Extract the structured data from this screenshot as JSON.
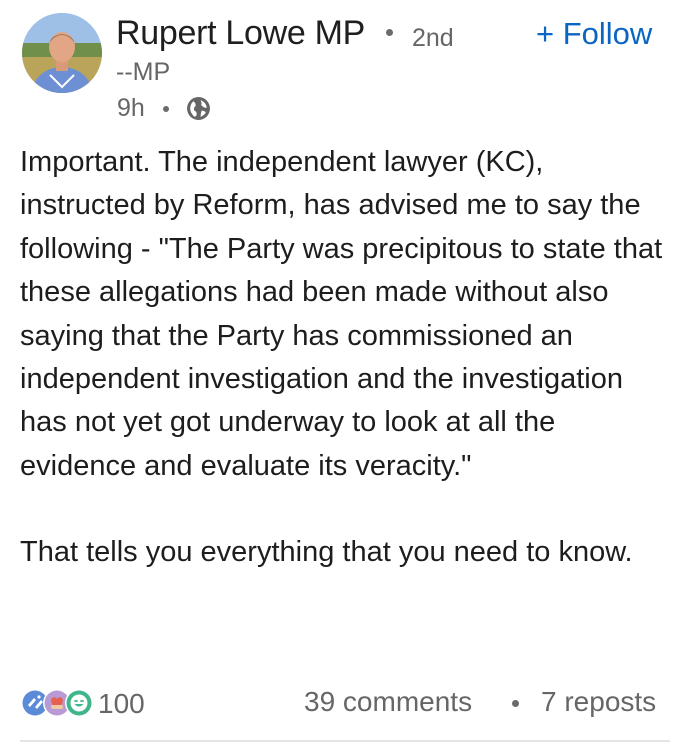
{
  "post": {
    "author": {
      "name": "Rupert Lowe MP",
      "degree": "2nd",
      "headline": "--MP",
      "avatar_icon": "profile-photo"
    },
    "follow_label": "+ Follow",
    "timestamp": "9h",
    "visibility_icon": "globe-icon",
    "body": {
      "paragraph1": "Important. The independent lawyer (KC), instructed by Reform, has advised me to say the following - \"The Party was precipitous to state that these allegations had been made without also saying that the Party has commissioned an independent investigation and the investigation has not yet got underway to look at all the evidence and evaluate its veracity.\"",
      "paragraph2": "That tells you everything that you need to know."
    },
    "social": {
      "reaction_icons": [
        "celebrate-icon",
        "support-icon",
        "funny-icon"
      ],
      "reaction_count": "100",
      "comments": "39 comments",
      "reposts": "7 reposts"
    }
  },
  "colors": {
    "link_blue": "#0a66c2",
    "meta_gray": "#666666",
    "text": "#1d1d1d"
  }
}
